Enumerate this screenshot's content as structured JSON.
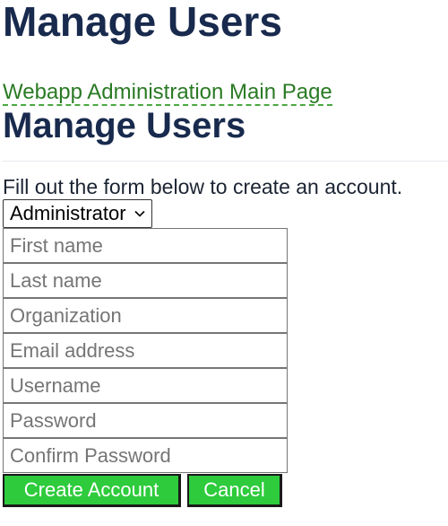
{
  "page": {
    "title": "Manage Users"
  },
  "nav": {
    "admin_link": "Webapp Administration Main Page"
  },
  "section": {
    "title": "Manage Users",
    "intro": "Fill out the form below to create an account."
  },
  "form": {
    "role": {
      "selected": "Administrator"
    },
    "fields": {
      "first_name": {
        "placeholder": "First name",
        "value": ""
      },
      "last_name": {
        "placeholder": "Last name",
        "value": ""
      },
      "organization": {
        "placeholder": "Organization",
        "value": ""
      },
      "email": {
        "placeholder": "Email address",
        "value": ""
      },
      "username": {
        "placeholder": "Username",
        "value": ""
      },
      "password": {
        "placeholder": "Password",
        "value": ""
      },
      "confirm_password": {
        "placeholder": "Confirm Password",
        "value": ""
      }
    },
    "buttons": {
      "create": "Create Account",
      "cancel": "Cancel"
    }
  },
  "colors": {
    "heading": "#182a4d",
    "link": "#2a7a24",
    "button_bg": "#2ecb3c",
    "button_text": "#ffffff"
  },
  "icons": {
    "role_dropdown": "chevron-down-icon"
  }
}
